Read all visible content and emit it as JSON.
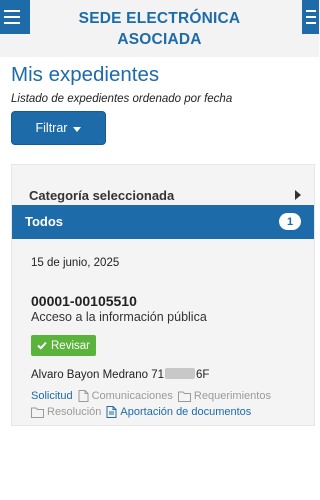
{
  "header": {
    "title_line1": "SEDE ELECTRÓNICA",
    "title_line2": "ASOCIADA"
  },
  "page": {
    "title": "Mis expedientes",
    "subtitle": "Listado de expedientes ordenado por fecha",
    "filter_label": "Filtrar"
  },
  "panel": {
    "category_title": "Categoría seleccionada",
    "todos_label": "Todos",
    "todos_count": "1"
  },
  "expediente": {
    "date": "15 de junio, 2025",
    "number": "00001-00105510",
    "type": "Acceso a la información pública",
    "status": "Revisar",
    "holder_name": "Alvaro Bayon Medrano",
    "holder_id_prefix": "71",
    "holder_id_suffix": "6F",
    "links": [
      {
        "label": "Solicitud",
        "active": true
      },
      {
        "label": "Comunicaciones",
        "active": false
      },
      {
        "label": "Requerimientos",
        "active": false
      },
      {
        "label": "Resolución",
        "active": false
      },
      {
        "label": "Aportación de documentos",
        "active": true
      }
    ]
  },
  "colors": {
    "brand_blue": "#1d6ba8",
    "status_green": "#5ab33b"
  },
  "icons": [
    "hamburger-menu-icon",
    "caret-down-icon",
    "caret-right-icon",
    "check-icon",
    "folder-icon",
    "document-icon"
  ]
}
